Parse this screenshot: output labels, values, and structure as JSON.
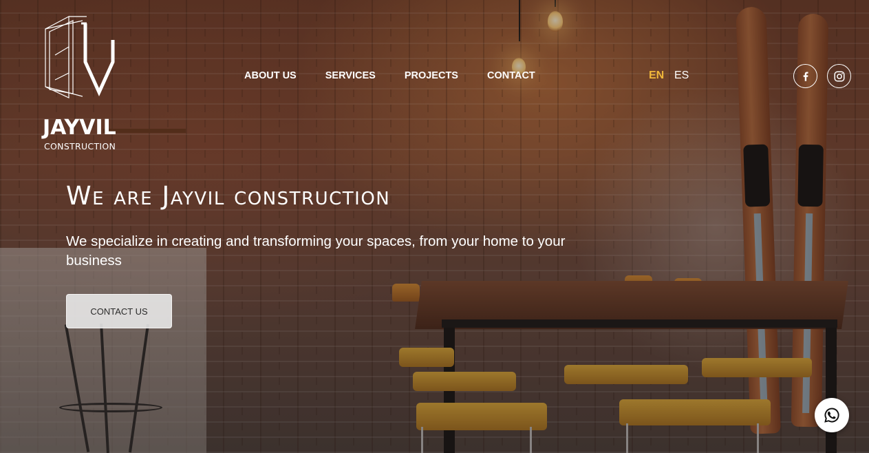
{
  "brand": {
    "name": "JAYVIL",
    "subtitle": "CONSTRUCTION"
  },
  "nav": {
    "items": [
      {
        "label": "ABOUT US"
      },
      {
        "label": "SERVICES"
      },
      {
        "label": "PROJECTS"
      },
      {
        "label": "CONTACT"
      }
    ]
  },
  "language": {
    "options": [
      "EN",
      "ES"
    ],
    "selected": "EN"
  },
  "social": {
    "icons": [
      "facebook-icon",
      "instagram-icon"
    ]
  },
  "hero": {
    "title": "We are Jayvil construction",
    "subtitle": "We specialize in creating and transforming your spaces, from your home to your business",
    "cta_label": "CONTACT US"
  },
  "floating": {
    "icon": "whatsapp-icon"
  },
  "colors": {
    "accent_language": "#f0b73a",
    "text": "#ffffff",
    "cta_background": "#ebebeb",
    "cta_text": "#2a2a2a"
  }
}
